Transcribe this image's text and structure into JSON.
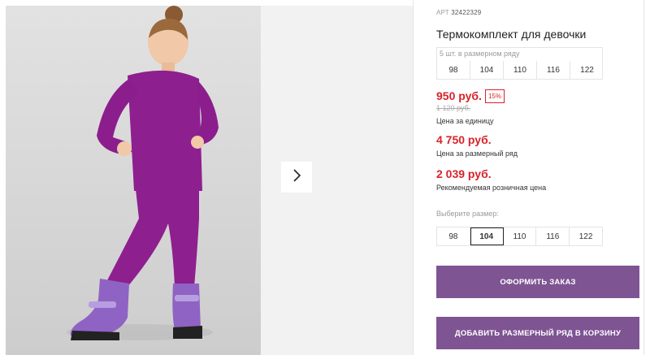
{
  "product": {
    "art_label": "АРТ",
    "art_value": "32422329",
    "title": "Термокомплект для девочки"
  },
  "size_set": {
    "caption": "5 шт. в размерном ряду",
    "sizes": [
      "98",
      "104",
      "110",
      "116",
      "122"
    ]
  },
  "pricing": {
    "unit_price": "950 руб.",
    "discount": "15%",
    "old_price": "1 120 руб.",
    "unit_label": "Цена за единицу",
    "set_price": "4 750 руб.",
    "set_label": "Цена за размерный ряд",
    "retail_price": "2 039 руб.",
    "retail_label": "Рекомендуемая розничная цена"
  },
  "size_select": {
    "caption": "Выберите размер:",
    "options": [
      "98",
      "104",
      "110",
      "116",
      "122"
    ],
    "selected": "104"
  },
  "actions": {
    "order_label": "ОФОРМИТЬ ЗАКАЗ",
    "add_set_label": "ДОБАВИТЬ РАЗМЕРНЫЙ РЯД В КОРЗИНУ"
  },
  "colors": {
    "accent_red": "#d8232a",
    "button_purple": "#7e5493",
    "garment_purple": "#8e1f8f"
  },
  "icons": {
    "next": "chevron-right-icon"
  }
}
